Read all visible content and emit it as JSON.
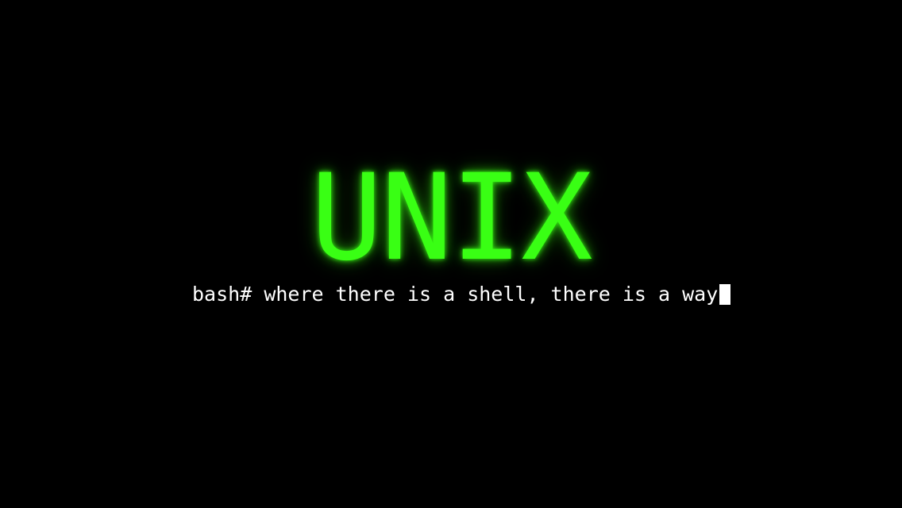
{
  "screen": {
    "title": "UNIX",
    "prompt": "bash#",
    "command_text": " where there is a shell, there is a way"
  },
  "colors": {
    "background": "#000000",
    "title": "#39ff14",
    "text": "#ffffff"
  }
}
